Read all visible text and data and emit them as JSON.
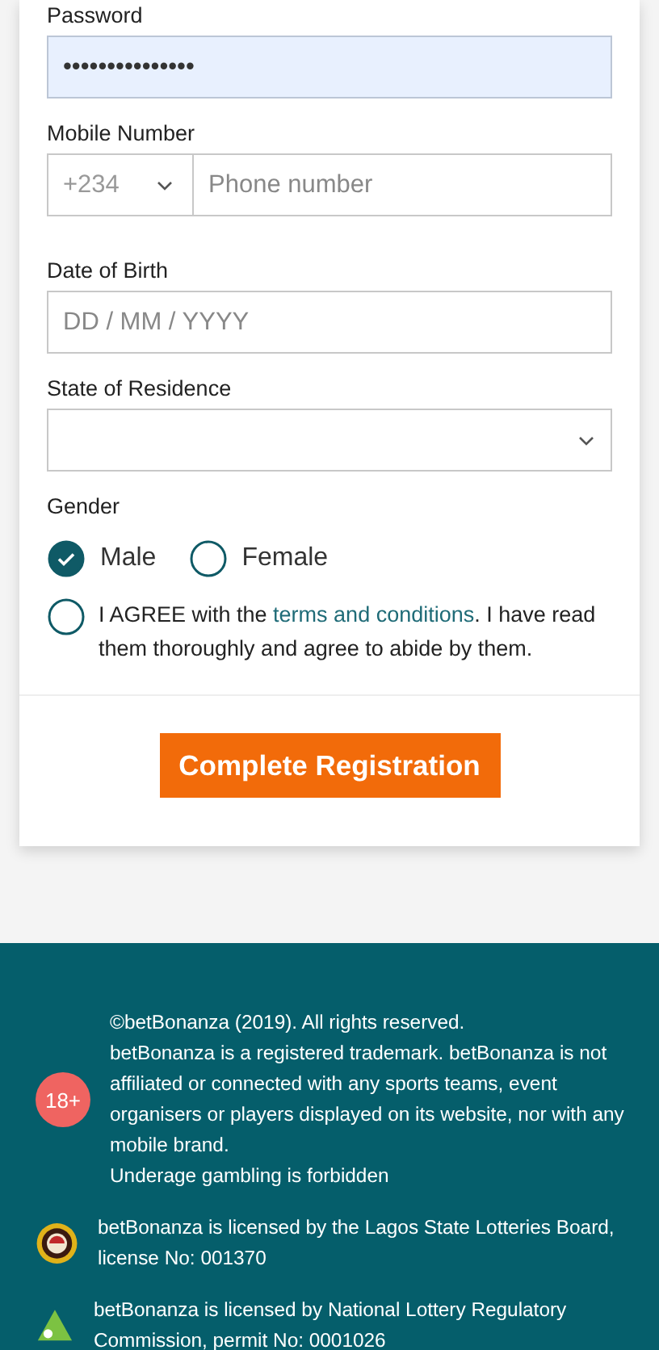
{
  "form": {
    "password": {
      "label": "Password",
      "value": "•••••••••••••••",
      "autofilled": true
    },
    "mobile": {
      "label": "Mobile Number",
      "country_code": "+234",
      "placeholder": "Phone number"
    },
    "date_of_birth": {
      "label": "Date of Birth",
      "placeholder": "DD / MM / YYYY"
    },
    "state_of_residence": {
      "label": "State of Residence"
    },
    "gender": {
      "label": "Gender",
      "options": [
        {
          "label": "Male",
          "selected": true
        },
        {
          "label": "Female",
          "selected": false
        }
      ]
    },
    "agreement": {
      "checked": false,
      "before": "I AGREE with the ",
      "link": "terms and conditions",
      "after": ". I have read them thoroughly and agree to abide by them."
    },
    "submit": "Complete Registration"
  },
  "footer": {
    "items": [
      {
        "kind": "age",
        "badge": "18+",
        "lines": [
          "©betBonanza (2019). All rights reserved.",
          "betBonanza is a registered trademark. betBonanza is not affiliated or connected with any sports teams, event organisers or players displayed on its website, nor with any mobile brand.",
          "Underage gambling is forbidden"
        ]
      },
      {
        "kind": "lagos",
        "lines": [
          "betBonanza is licensed by the Lagos State Lotteries Board, license No: 001370"
        ]
      },
      {
        "kind": "nlrc",
        "lines": [
          "betBonanza is licensed by National Lottery Regulatory Commission, permit No: 0001026"
        ]
      }
    ]
  }
}
